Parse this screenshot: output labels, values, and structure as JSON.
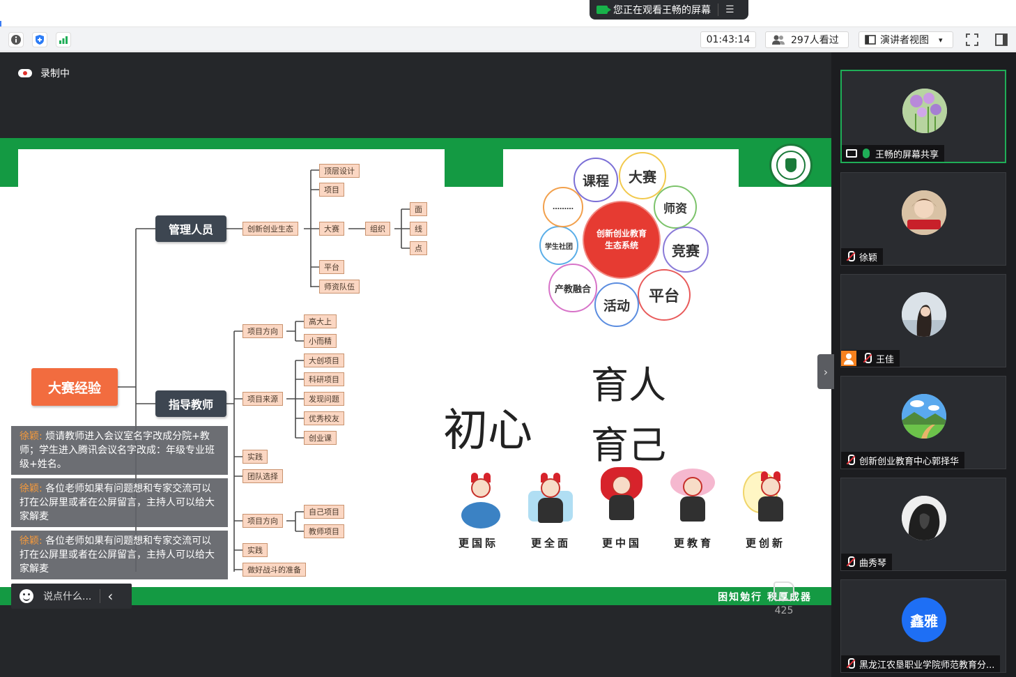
{
  "sharing_banner": {
    "text": "您正在观看王畅的屏幕",
    "menu_glyph": "☰"
  },
  "toolbar": {
    "timer": "01:43:14",
    "viewers": "297人看过",
    "view_mode": "演讲者视图",
    "view_mode_caret": "▾"
  },
  "recording": {
    "label": "录制中"
  },
  "slide": {
    "slogan": "困知勉行 积厚成器",
    "mindmap": {
      "root": "大赛经验",
      "branches": [
        {
          "label": "管理人员"
        },
        {
          "label": "指导教师"
        }
      ],
      "nodes": {
        "eco": "创新创业生态",
        "top_design": "顶层设计",
        "project": "项目",
        "contest": "大赛",
        "organize": "组织",
        "face": "面",
        "line": "线",
        "point": "点",
        "platform": "平台",
        "faculty": "师资队伍",
        "proj_dir1": "项目方向",
        "high": "高大上",
        "small": "小而精",
        "proj_src": "项目来源",
        "dachuang": "大创项目",
        "research": "科研项目",
        "discover": "发现问题",
        "alumni": "优秀校友",
        "course": "创业课",
        "practice1": "实践",
        "team": "团队选择",
        "proj_dir2": "项目方向",
        "own": "自己项目",
        "teacher_proj": "教师项目",
        "practice2": "实践",
        "prepare": "做好战斗的准备"
      }
    },
    "ecosystem": {
      "core_line1": "创新创业教育",
      "core_line2": "生态系统",
      "petals": [
        "课程",
        "大赛",
        "师资",
        "竞赛",
        "平台",
        "活动",
        "产教融合",
        "学生社团",
        "………"
      ]
    },
    "calligraphy": {
      "chuxin": "初心",
      "yuren": "育人",
      "yuji": "育己"
    },
    "mascots": [
      "更国际",
      "更全面",
      "更中国",
      "更教育",
      "更创新"
    ]
  },
  "chat": {
    "messages": [
      {
        "who": "徐颖:",
        "text": " 烦请教师进入会议室名字改成分院+教师；学生进入腾讯会议名字改成：年级专业班级+姓名。"
      },
      {
        "who": "徐颖:",
        "text": " 各位老师如果有问题想和专家交流可以打在公屏里或者在公屏留言，主持人可以给大家解麦"
      },
      {
        "who": "徐颖:",
        "text": " 各位老师如果有问题想和专家交流可以打在公屏里或者在公屏留言，主持人可以给大家解麦"
      }
    ],
    "input_placeholder": "说点什么...",
    "collapse_glyph": "‹"
  },
  "likes": {
    "count": "425"
  },
  "gallery": {
    "handle_glyph": "›",
    "tiles": [
      {
        "name": "王畅的屏幕共享"
      },
      {
        "name": "徐颖"
      },
      {
        "name": "王佳"
      },
      {
        "name": "创新创业教育中心郭择华"
      },
      {
        "name": "曲秀琴"
      },
      {
        "name": "黑龙江农垦职业学院师范教育分...",
        "avatar_text": "鑫雅"
      }
    ]
  },
  "colors": {
    "slide_green": "#149a43",
    "root_orange": "#f26c3f",
    "core_red": "#e63b32",
    "active_border": "#1fae57"
  }
}
